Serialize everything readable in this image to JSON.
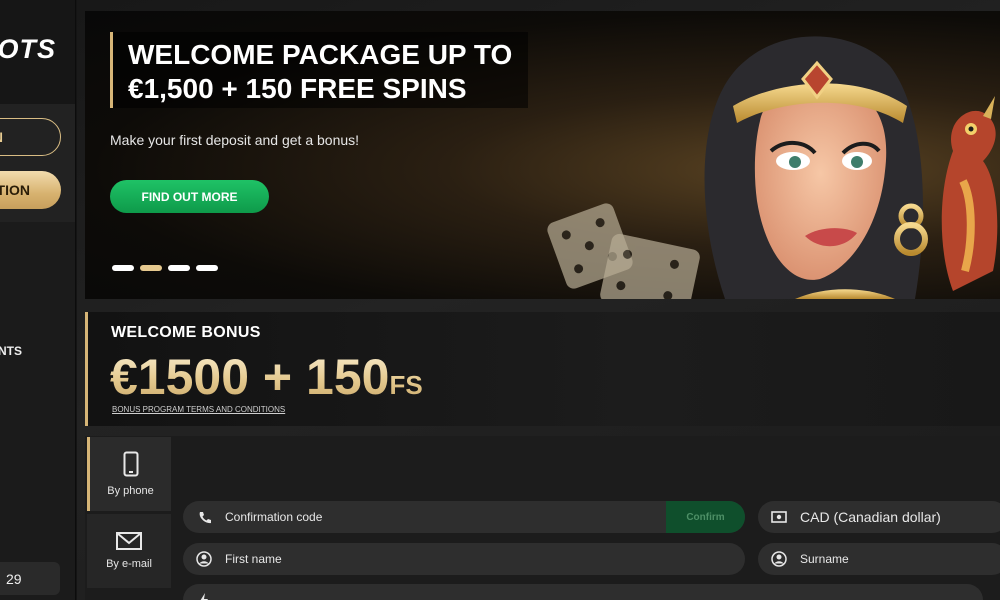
{
  "sidebar": {
    "logo_text": "OTS",
    "login_label": "N",
    "register_label": "TION",
    "nav_text": "NTS",
    "counter": "29"
  },
  "banner": {
    "title_line1": "WELCOME PACKAGE UP TO",
    "title_line2": "€1,500 + 150 FREE SPINS",
    "subtitle": "Make your first deposit and get a bonus!",
    "cta_label": "FIND OUT MORE",
    "slides": 4,
    "active_slide": 1
  },
  "bonus": {
    "label": "WELCOME BONUS",
    "amount": "€1500 + 150",
    "amount_suffix": "FS",
    "terms_link": "BONUS PROGRAM TERMS AND CONDITIONS"
  },
  "registration": {
    "tabs": [
      {
        "label": "By phone",
        "icon": "phone-icon",
        "active": true
      },
      {
        "label": "By e-mail",
        "icon": "envelope-icon",
        "active": false
      }
    ],
    "phone_field": {
      "placeholder": "Confirmation code",
      "button": "Confirm"
    },
    "currency_field": {
      "value": "CAD (Canadian dollar)"
    },
    "first_name_field": {
      "placeholder": "First name"
    },
    "surname_field": {
      "placeholder": "Surname"
    }
  },
  "colors": {
    "gold": "#d6b577",
    "green_cta": "#13a855",
    "background": "#141414"
  }
}
